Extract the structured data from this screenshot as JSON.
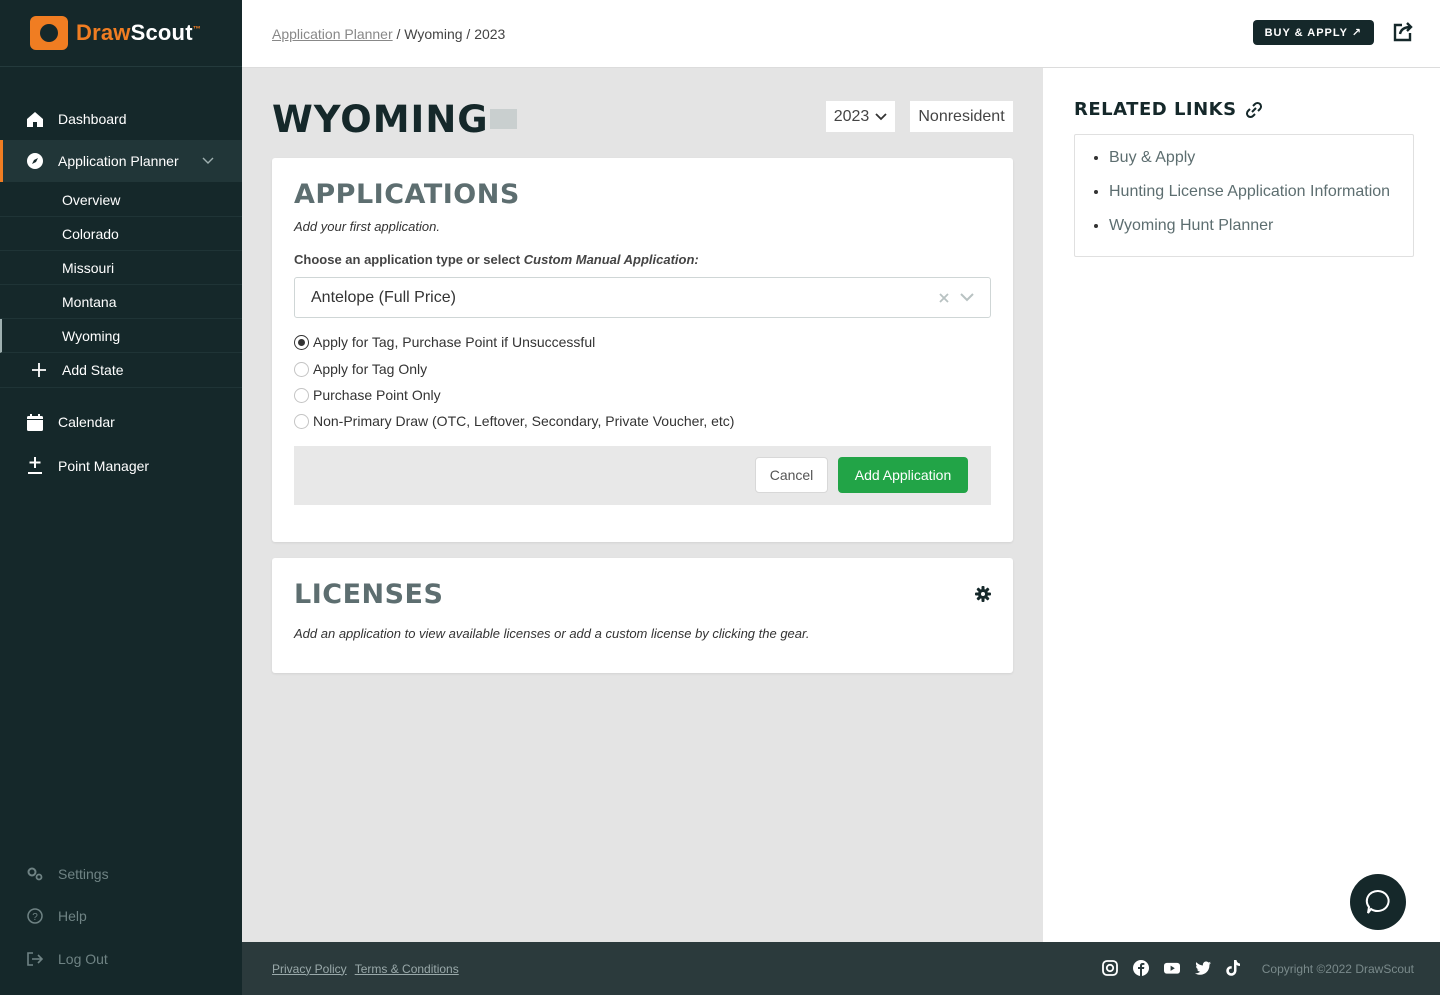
{
  "brand": {
    "name_a": "Draw",
    "name_b": "Scout",
    "tm": "™"
  },
  "sidebar": {
    "items": [
      {
        "label": "Dashboard",
        "icon": "home-icon"
      },
      {
        "label": "Application Planner",
        "icon": "compass-icon"
      },
      {
        "label": "Add State",
        "icon": "plus-icon"
      },
      {
        "label": "Calendar",
        "icon": "calendar-icon"
      },
      {
        "label": "Point Manager",
        "icon": "plus-minus-icon"
      }
    ],
    "sub_items": [
      "Overview",
      "Colorado",
      "Missouri",
      "Montana",
      "Wyoming"
    ],
    "bottom": [
      {
        "label": "Settings",
        "icon": "gears-icon"
      },
      {
        "label": "Help",
        "icon": "help-icon"
      },
      {
        "label": "Log Out",
        "icon": "logout-icon"
      }
    ]
  },
  "breadcrumb": {
    "link": "Application Planner",
    "rest": " / Wyoming / 2023"
  },
  "header": {
    "buy_label": "BUY & APPLY ↗"
  },
  "page": {
    "title": "WYOMING",
    "year": "2023",
    "residency": "Nonresident"
  },
  "applications": {
    "title": "APPLICATIONS",
    "subtitle": "Add your first application.",
    "choose_prefix": "Choose an application type or select ",
    "choose_em": "Custom Manual Application:",
    "selected": "Antelope (Full Price)",
    "options": [
      "Apply for Tag, Purchase Point if Unsuccessful",
      "Apply for Tag Only",
      "Purchase Point Only",
      "Non-Primary Draw (OTC, Leftover, Secondary, Private Voucher, etc)"
    ],
    "cancel": "Cancel",
    "add": "Add Application"
  },
  "licenses": {
    "title": "LICENSES",
    "subtitle": "Add an application to view available licenses or add a custom license by clicking the gear."
  },
  "related": {
    "title": "RELATED LINKS",
    "links": [
      "Buy & Apply",
      "Hunting License Application Information",
      "Wyoming Hunt Planner"
    ]
  },
  "footer": {
    "privacy": "Privacy Policy",
    "terms": "Terms & Conditions",
    "copyright": "Copyright ©2022 DrawScout",
    "social": [
      "instagram-icon",
      "facebook-icon",
      "youtube-icon",
      "twitter-icon",
      "tiktok-icon"
    ]
  },
  "colors": {
    "sidebar": "#15282a",
    "accent": "#f07d22",
    "green": "#22a447"
  }
}
